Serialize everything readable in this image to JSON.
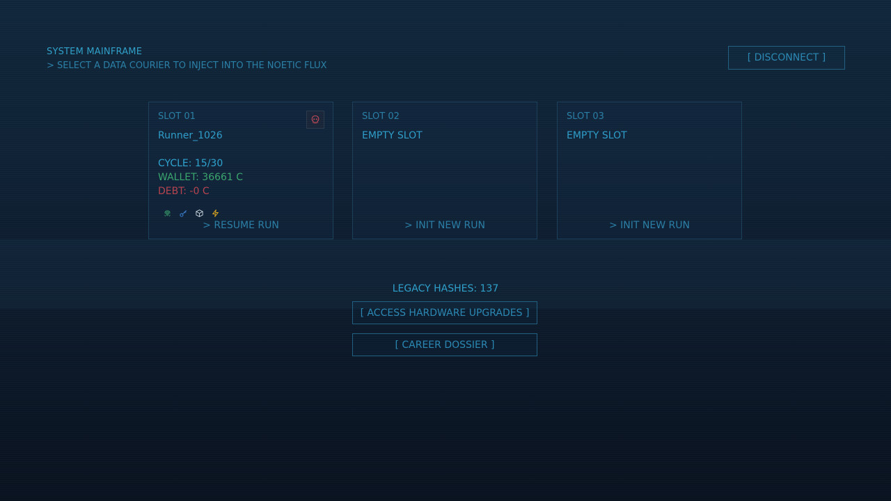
{
  "header": {
    "title": "SYSTEM MAINFRAME",
    "subtitle": "> SELECT A DATA COURIER TO INJECT INTO THE NOETIC FLUX",
    "disconnect_label": "[ DISCONNECT ]"
  },
  "slots": [
    {
      "label": "SLOT 01",
      "name": "Runner_1026",
      "cycle": "CYCLE:  15/30",
      "wallet": "WALLET: 36661 C",
      "debt": "DEBT:  -0 C",
      "action": "> RESUME RUN",
      "status_icon": "skull-icon",
      "items": [
        "fingerprint-icon",
        "key-icon",
        "cube-icon",
        "lightning-icon"
      ]
    },
    {
      "label": "SLOT 02",
      "name": "EMPTY SLOT",
      "action": "> INIT NEW RUN"
    },
    {
      "label": "SLOT 03",
      "name": "EMPTY SLOT",
      "action": "> INIT NEW RUN"
    }
  ],
  "legacy": {
    "hashes_label": "LEGACY HASHES: 137"
  },
  "menu": {
    "upgrades_label": "[ ACCESS HARDWARE UPGRADES ]",
    "dossier_label": "[ CAREER DOSSIER ]"
  },
  "colors": {
    "accent": "#2a8db6",
    "wallet": "#3aa56d",
    "debt": "#b5434f"
  }
}
